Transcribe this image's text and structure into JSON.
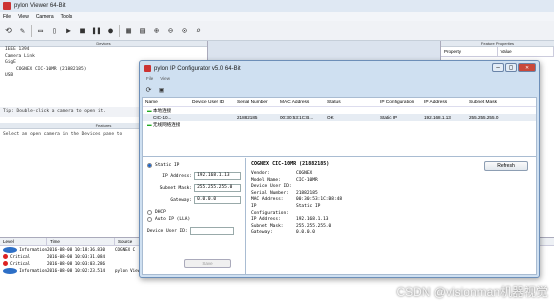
{
  "app": {
    "title": "pylon Viewer 64-Bit",
    "menu": [
      "File",
      "View",
      "Camera",
      "Tools"
    ]
  },
  "devices": {
    "title": "Devices",
    "items": [
      "IEEE 1394",
      "Camera Link",
      "GigE",
      "COGNEX CIC-10MR (21882185)",
      "USB"
    ]
  },
  "tip": "Tip: Double-click a camera to open it.",
  "features": {
    "title": "Features",
    "message": "Select an open camera in the Devices pane to"
  },
  "feature_properties": {
    "title": "Feature Properties",
    "columns": [
      "Property",
      "Value"
    ]
  },
  "log": {
    "columns": [
      "Level",
      "Time",
      "Source"
    ],
    "rows": [
      {
        "level": "Information",
        "type": "info",
        "time": "2016-08-08 10:18:36.830",
        "source": "COGNEX C"
      },
      {
        "level": "Critical",
        "type": "crit",
        "time": "2016-08-08 10:03:31.084",
        "source": ""
      },
      {
        "level": "Critical",
        "type": "crit",
        "time": "2016-08-08 10:03:03.286",
        "source": ""
      },
      {
        "level": "Information",
        "type": "info",
        "time": "2016-08-08 10:02:23.514",
        "source": "pylon Viewer"
      }
    ],
    "extra_messages": [
      "Failed to find camera. Check the IP configuration",
      "pylon Viewer 5.0.0.6150 64-Bit has been started"
    ]
  },
  "dialog": {
    "title": "pylon IP Configurator v5.0 64-Bit",
    "menu": [
      "File",
      "View"
    ],
    "columns": [
      "Name",
      "Device User ID",
      "Serial Number",
      "MAC Address",
      "Status",
      "IP Configuration",
      "IP Address",
      "Subnet Mask"
    ],
    "groups": [
      {
        "label": "本地连接",
        "rows": [
          {
            "name": "CIC-10...",
            "user_id": "",
            "serial": "21882185",
            "mac": "00:30:53:1C:B...",
            "status": "OK",
            "ipcfg": "Static IP",
            "ip": "192.168.1.13",
            "mask": "255.255.255.0"
          }
        ]
      },
      {
        "label": "无线网络连接",
        "rows": []
      }
    ],
    "form": {
      "static_ip": "Static IP",
      "ip_label": "IP Address:",
      "ip": "192.168.1.13",
      "mask_label": "Subnet Mask:",
      "mask": "255.255.255.0",
      "gw_label": "Gateway:",
      "gw": "0.0.0.0",
      "dhcp": "DHCP",
      "autoip": "Auto IP (LLA)",
      "uid_label": "Device User ID:",
      "uid": "",
      "save": "Save"
    },
    "info": {
      "header": "COGNEX CIC-10MR (21882185)",
      "refresh": "Refresh",
      "fields": [
        [
          "Vendor:",
          "COGNEX"
        ],
        [
          "Model Name:",
          "CIC-10MR"
        ],
        [
          "Device User ID:",
          ""
        ],
        [
          "Serial Number:",
          "21882185"
        ],
        [
          "MAC Address:",
          "00:30:53:1C:B8:48"
        ],
        [
          "IP Configuration:",
          "Static IP"
        ],
        [
          "IP Address:",
          "192.168.1.13"
        ],
        [
          "Subnet Mask:",
          "255.255.255.0"
        ],
        [
          "Gateway:",
          "0.0.0.0"
        ]
      ]
    }
  },
  "watermark": "CSDN @visionman机器视觉"
}
